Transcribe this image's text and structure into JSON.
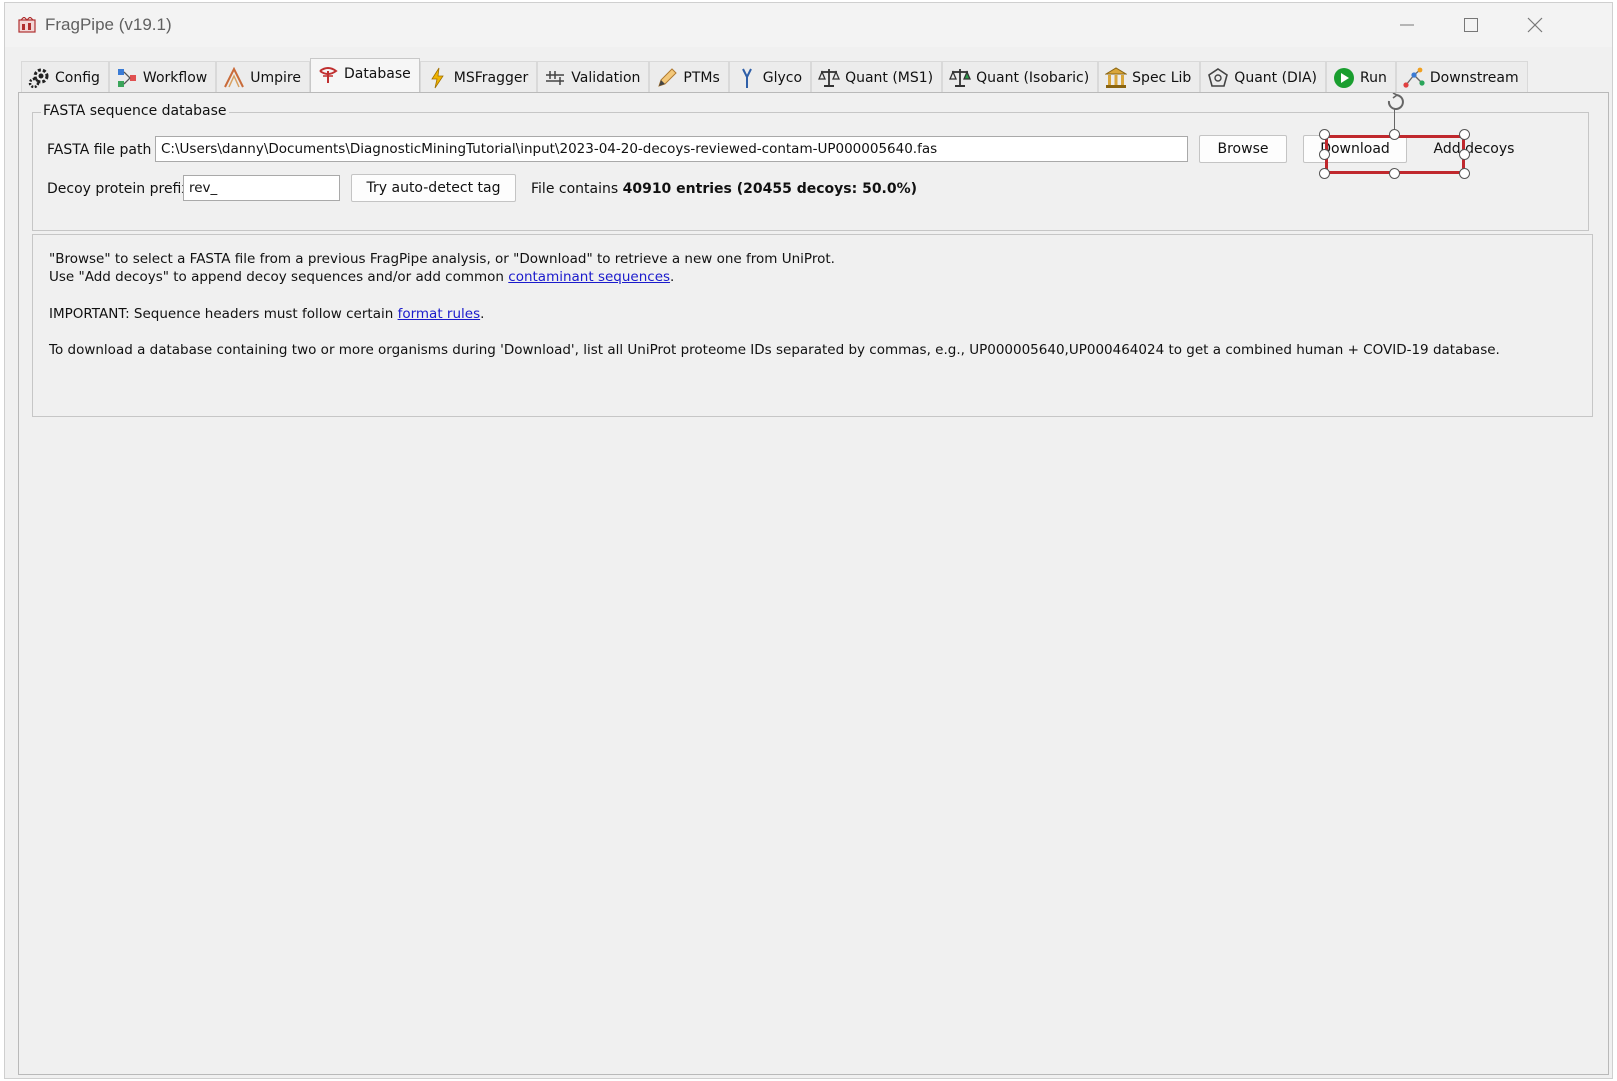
{
  "window": {
    "title": "FragPipe (v19.1)"
  },
  "tabs": [
    {
      "label": "Config",
      "icon": "gear-icon"
    },
    {
      "label": "Workflow",
      "icon": "workflow-icon"
    },
    {
      "label": "Umpire",
      "icon": "umpire-icon"
    },
    {
      "label": "Database",
      "icon": "database-icon",
      "active": true
    },
    {
      "label": "MSFragger",
      "icon": "lightning-icon"
    },
    {
      "label": "Validation",
      "icon": "validation-icon"
    },
    {
      "label": "PTMs",
      "icon": "pencil-icon"
    },
    {
      "label": "Glyco",
      "icon": "glyco-icon"
    },
    {
      "label": "Quant (MS1)",
      "icon": "scale-icon"
    },
    {
      "label": "Quant (Isobaric)",
      "icon": "scale-icon"
    },
    {
      "label": "Spec Lib",
      "icon": "library-icon"
    },
    {
      "label": "Quant (DIA)",
      "icon": "dia-icon"
    },
    {
      "label": "Run",
      "icon": "play-icon"
    },
    {
      "label": "Downstream",
      "icon": "downstream-icon"
    }
  ],
  "fasta": {
    "group_title": "FASTA sequence database",
    "path_label": "FASTA file path",
    "path_value": "C:\\Users\\danny\\Documents\\DiagnosticMiningTutorial\\input\\2023-04-20-decoys-reviewed-contam-UP000005640.fas",
    "browse_label": "Browse",
    "download_label": "Download",
    "add_decoys_label": "Add decoys",
    "decoy_prefix_label": "Decoy protein prefix",
    "decoy_prefix_value": "rev_",
    "autodetect_label": "Try auto-detect tag",
    "file_contains_prefix": "File contains ",
    "file_contains_stats": "40910 entries (20455 decoys: 50.0%)"
  },
  "info": {
    "line1": "\"Browse\" to select a FASTA file from a previous FragPipe analysis, or \"Download\" to retrieve a new one from UniProt.",
    "line2_prefix": "Use \"Add decoys\" to append decoy sequences and/or add common ",
    "line2_link": "contaminant sequences",
    "line2_suffix": ".",
    "line3_prefix": "IMPORTANT: Sequence headers must follow certain ",
    "line3_link": "format rules",
    "line3_suffix": ".",
    "line4": "To download a database containing two or more organisms during 'Download', list all UniProt proteome IDs separated by commas, e.g., UP000005640,UP000464024 to get a combined human + COVID-19 database."
  },
  "colors": {
    "selection_border": "#c0282d",
    "link": "#1a1acc",
    "run_icon": "#1a9e2f"
  }
}
